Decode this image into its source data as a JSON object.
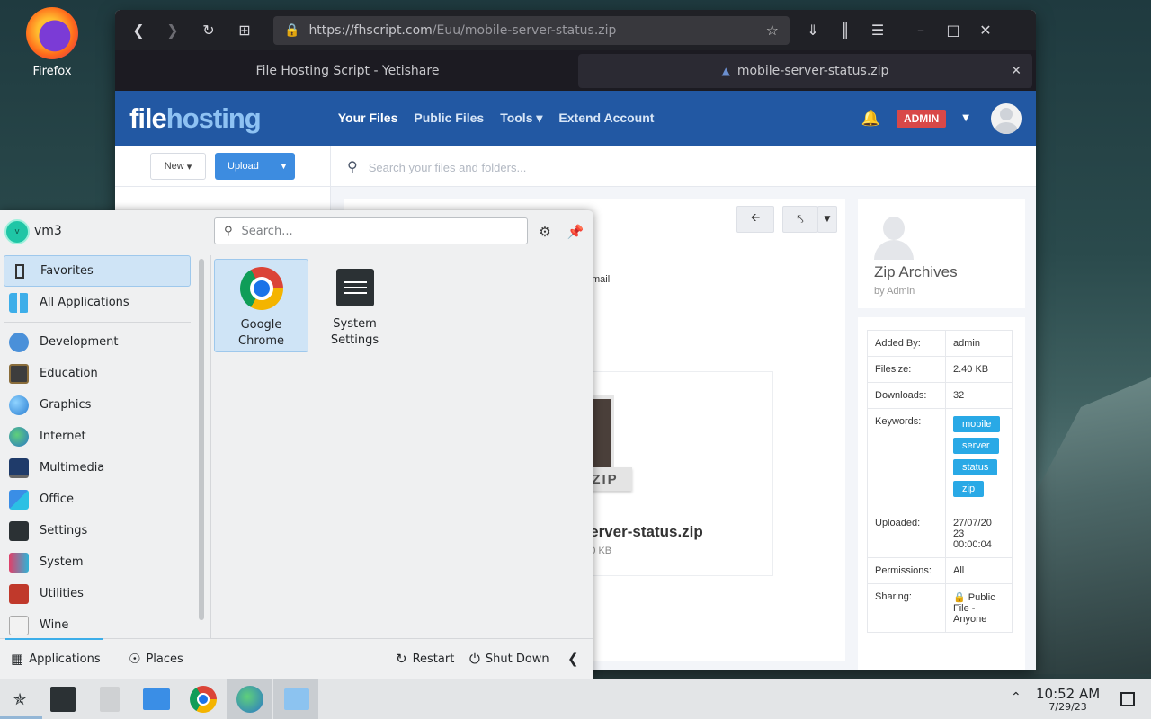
{
  "desktop": {
    "firefox_label": "Firefox"
  },
  "browser": {
    "url_host": "https://fhscript.com",
    "url_path": "/Euu/mobile-server-status.zip",
    "tabs": [
      {
        "label": "File Hosting Script - Yetishare"
      },
      {
        "label": "mobile-server-status.zip"
      }
    ]
  },
  "site": {
    "logo_part1": "file",
    "logo_part2": "hosting",
    "nav": [
      "Your Files",
      "Public Files",
      "Tools",
      "Extend Account"
    ],
    "admin_badge": "ADMIN",
    "new_label": "New",
    "upload_label": "Upload",
    "search_placeholder": "Search your files and folders...",
    "email_fragment": "mail",
    "file_title": "-server-status.zip",
    "file_size": "2.40 KB",
    "zip_tag": "ZIP",
    "owner_name": "Zip Archives",
    "owner_by": "by Admin",
    "info": {
      "added_by_label": "Added By:",
      "added_by": "admin",
      "filesize_label": "Filesize:",
      "filesize": "2.40 KB",
      "downloads_label": "Downloads:",
      "downloads": "32",
      "keywords_label": "Keywords:",
      "keywords": [
        "mobile",
        "server",
        "status",
        "zip"
      ],
      "uploaded_label": "Uploaded:",
      "uploaded_l1": "27/07/20",
      "uploaded_l2": "23",
      "uploaded_l3": "00:00:04",
      "permissions_label": "Permissions:",
      "permissions": "All",
      "sharing_label": "Sharing:",
      "sharing_l1": "Public",
      "sharing_l2": "File -",
      "sharing_l3": "Anyone"
    }
  },
  "launcher": {
    "user": "vm3",
    "avatar_letter": "v",
    "search_placeholder": "Search...",
    "categories": [
      "Favorites",
      "All Applications",
      "Development",
      "Education",
      "Graphics",
      "Internet",
      "Multimedia",
      "Office",
      "Settings",
      "System",
      "Utilities",
      "Wine"
    ],
    "apps": [
      {
        "line1": "Google",
        "line2": "Chrome"
      },
      {
        "line1": "System",
        "line2": "Settings"
      }
    ],
    "footer": {
      "applications": "Applications",
      "places": "Places",
      "restart": "Restart",
      "shutdown": "Shut Down"
    }
  },
  "taskbar": {
    "time": "10:52 AM",
    "date": "7/29/23"
  },
  "colors": {
    "accent": "#3daee9",
    "site_header": "#2258a3",
    "admin": "#d84848",
    "keyword": "#29a9e6"
  }
}
